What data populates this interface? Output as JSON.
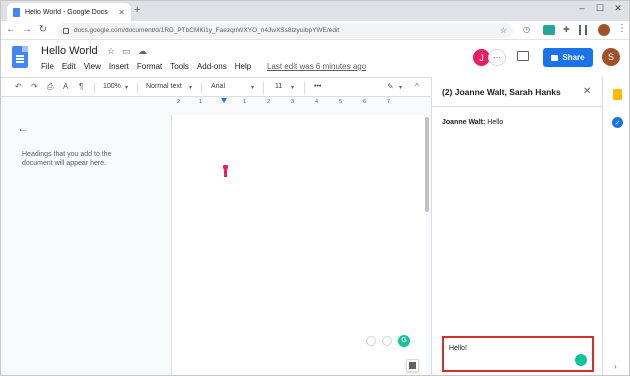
{
  "browser": {
    "tab_title": "Hello World - Google Docs",
    "tab_close": "✕",
    "new_tab": "+",
    "url": "docs.google.com/document/d/1RD_PTbCMKi1y_FaezqnWXYO_n4JwXSs8tzyuibpYWE/edit",
    "window_controls": [
      "–",
      "☐",
      "✕"
    ]
  },
  "docs": {
    "title": "Hello World",
    "menu": [
      "File",
      "Edit",
      "View",
      "Insert",
      "Format",
      "Tools",
      "Add-ons",
      "Help"
    ],
    "last_edit": "Last edit was 6 minutes ago",
    "share_label": "Share",
    "avatar_j": "J",
    "avatar_s": "S"
  },
  "toolbar": {
    "zoom": "100%",
    "style": "Normal text",
    "font": "Arial",
    "size": "11",
    "more": "•••"
  },
  "outline": {
    "hint": "Headings that you add to the document will appear here."
  },
  "ruler": {
    "ticks": [
      "2",
      "1",
      "1",
      "2",
      "3",
      "4",
      "5",
      "6",
      "7"
    ]
  },
  "chat": {
    "title": "(2) Joanne Walt, Sarah Hanks",
    "messages": [
      {
        "sender": "Joanne Walt:",
        "text": "Hello"
      }
    ],
    "draft": "Hello!"
  },
  "colors": {
    "accent": "#1a73e8",
    "highlight": "#d32f2f",
    "grammarly": "#15c39a"
  }
}
